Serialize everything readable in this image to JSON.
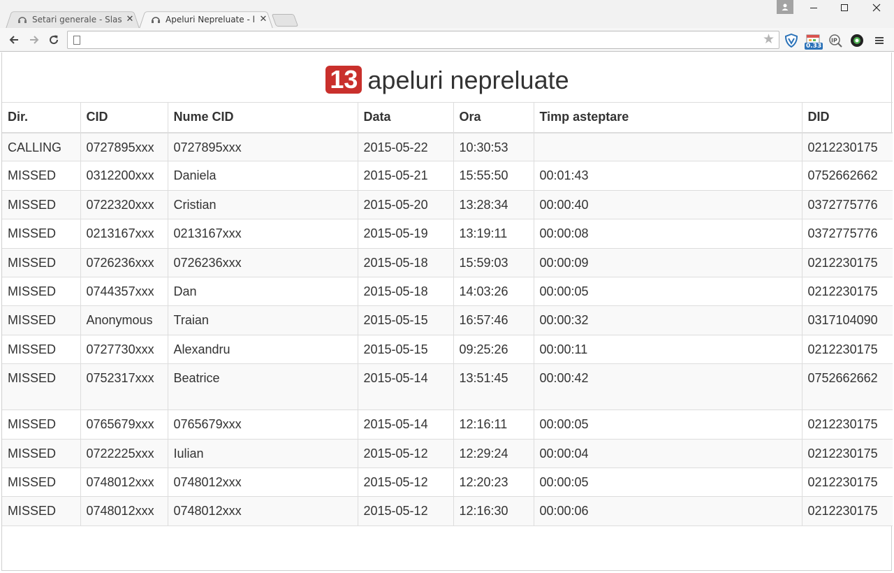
{
  "browser": {
    "tabs": [
      {
        "title": "Setari generale - Slash PBX",
        "active": false
      },
      {
        "title": "Apeluri Nepreluate - live",
        "active": true
      }
    ],
    "url": "",
    "extension_badge": "0.33"
  },
  "page": {
    "count": "13",
    "heading": "apeluri nepreluate",
    "table": {
      "headers": [
        "Dir.",
        "CID",
        "Nume CID",
        "Data",
        "Ora",
        "Timp asteptare",
        "DID"
      ],
      "rows": [
        [
          "CALLING",
          "0727895xxx",
          "0727895xxx",
          "2015-05-22",
          "10:30:53",
          "",
          "0212230175"
        ],
        [
          "MISSED",
          "0312200xxx",
          "Daniela",
          "2015-05-21",
          "15:55:50",
          "00:01:43",
          "0752662662"
        ],
        [
          "MISSED",
          "0722320xxx",
          "Cristian",
          "2015-05-20",
          "13:28:34",
          "00:00:40",
          "0372775776"
        ],
        [
          "MISSED",
          "0213167xxx",
          "0213167xxx",
          "2015-05-19",
          "13:19:11",
          "00:00:08",
          "0372775776"
        ],
        [
          "MISSED",
          "0726236xxx",
          "0726236xxx",
          "2015-05-18",
          "15:59:03",
          "00:00:09",
          "0212230175"
        ],
        [
          "MISSED",
          "0744357xxx",
          "Dan",
          "2015-05-18",
          "14:03:26",
          "00:00:05",
          "0212230175"
        ],
        [
          "MISSED",
          "Anonymous",
          "Traian",
          "2015-05-15",
          "16:57:46",
          "00:00:32",
          "0317104090"
        ],
        [
          "MISSED",
          "0727730xxx",
          "Alexandru",
          "2015-05-15",
          "09:25:26",
          "00:00:11",
          "0212230175"
        ],
        [
          "MISSED",
          "0752317xxx",
          "Beatrice",
          "2015-05-14",
          "13:51:45",
          "00:00:42",
          "0752662662"
        ],
        [
          "MISSED",
          "0765679xxx",
          "0765679xxx",
          "2015-05-14",
          "12:16:11",
          "00:00:05",
          "0212230175"
        ],
        [
          "MISSED",
          "0722225xxx",
          "Iulian",
          "2015-05-12",
          "12:29:24",
          "00:00:04",
          "0212230175"
        ],
        [
          "MISSED",
          "0748012xxx",
          "0748012xxx",
          "2015-05-12",
          "12:20:23",
          "00:00:05",
          "0212230175"
        ],
        [
          "MISSED",
          "0748012xxx",
          "0748012xxx",
          "2015-05-12",
          "12:16:30",
          "00:00:06",
          "0212230175"
        ]
      ]
    }
  },
  "colors": {
    "badge": "#c9302c",
    "stripe": "#f9f9f9",
    "border": "#dddddd"
  }
}
